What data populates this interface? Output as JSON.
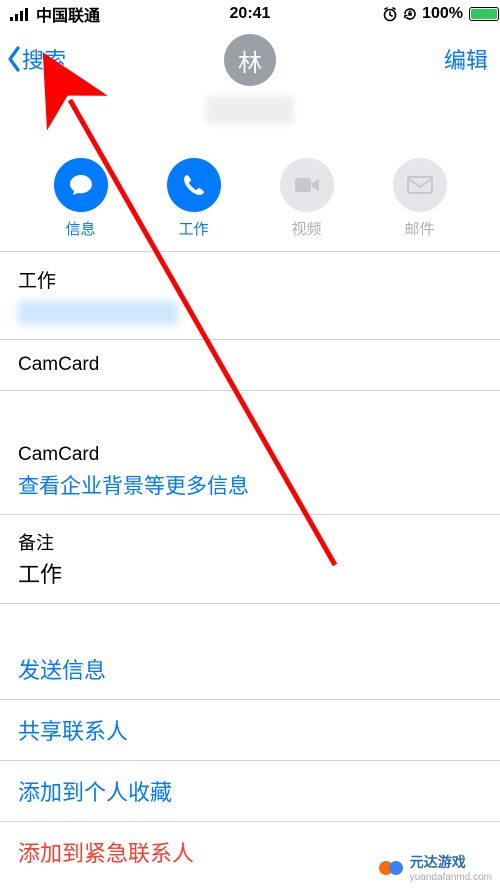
{
  "status": {
    "carrier": "中国联通",
    "time": "20:41",
    "battery_pct": "100%"
  },
  "nav": {
    "back_label": "搜索",
    "edit_label": "编辑"
  },
  "contact": {
    "avatar_initial": "林"
  },
  "actions": {
    "message": "信息",
    "work_call": "工作",
    "video": "视频",
    "mail": "邮件"
  },
  "fields": {
    "phone_label": "工作",
    "camcard1_label": "CamCard",
    "camcard2_label": "CamCard",
    "camcard2_link": "查看企业背景等更多信息",
    "notes_label": "备注",
    "notes_value": "工作"
  },
  "links": {
    "send_message": "发送信息",
    "share_contact": "共享联系人",
    "add_favorite": "添加到个人收藏",
    "add_emergency": "添加到紧急联系人"
  },
  "watermark": {
    "text": "元达游戏",
    "url": "yuandafanmd.com"
  }
}
